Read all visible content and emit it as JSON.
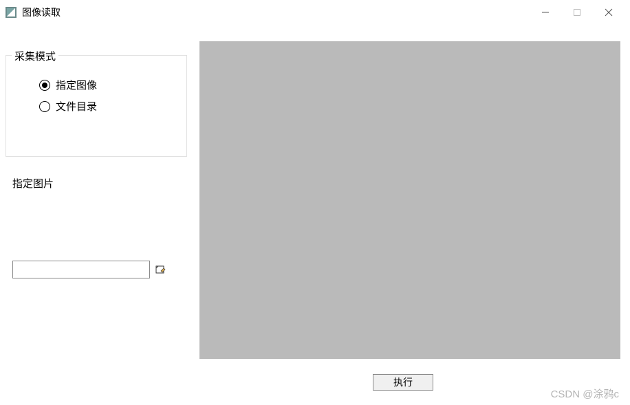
{
  "window": {
    "title": "图像读取"
  },
  "capture_mode": {
    "group_label": "采集模式",
    "options": [
      {
        "label": "指定图像",
        "selected": true
      },
      {
        "label": "文件目录",
        "selected": false
      }
    ]
  },
  "sub_label": "指定图片",
  "path": {
    "value": "",
    "placeholder": ""
  },
  "run_button_label": "执行",
  "watermark": "CSDN @涂鸦c"
}
